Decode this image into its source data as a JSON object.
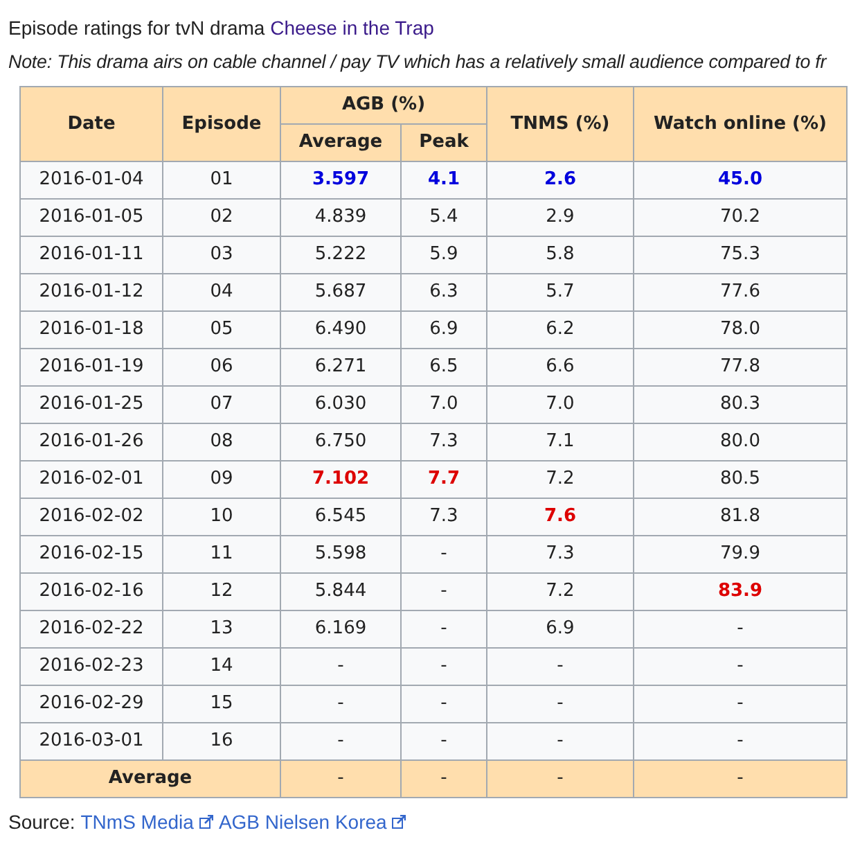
{
  "caption": {
    "text": "Episode ratings for tvN drama ",
    "link": "Cheese in the Trap"
  },
  "note": "Note: This drama airs on cable channel / pay TV which has a relatively small audience compared to fr",
  "table": {
    "columns": {
      "date": "Date",
      "episode": "Episode",
      "agb": "AGB (%)",
      "agb_average": "Average",
      "agb_peak": "Peak",
      "tnms": "TNMS (%)",
      "online": "Watch online (%)"
    },
    "rows": [
      {
        "date": "2016-01-04",
        "episode": "01",
        "values": [
          {
            "text": "3.597",
            "lowest": true,
            "highest": false
          },
          {
            "text": "4.1",
            "lowest": true,
            "highest": false
          },
          {
            "text": "2.6",
            "lowest": true,
            "highest": false
          },
          {
            "text": "45.0",
            "lowest": true,
            "highest": false
          }
        ]
      },
      {
        "date": "2016-01-05",
        "episode": "02",
        "values": [
          {
            "text": "4.839",
            "lowest": false,
            "highest": false
          },
          {
            "text": "5.4",
            "lowest": false,
            "highest": false
          },
          {
            "text": "2.9",
            "lowest": false,
            "highest": false
          },
          {
            "text": "70.2",
            "lowest": false,
            "highest": false
          }
        ]
      },
      {
        "date": "2016-01-11",
        "episode": "03",
        "values": [
          {
            "text": "5.222",
            "lowest": false,
            "highest": false
          },
          {
            "text": "5.9",
            "lowest": false,
            "highest": false
          },
          {
            "text": "5.8",
            "lowest": false,
            "highest": false
          },
          {
            "text": "75.3",
            "lowest": false,
            "highest": false
          }
        ]
      },
      {
        "date": "2016-01-12",
        "episode": "04",
        "values": [
          {
            "text": "5.687",
            "lowest": false,
            "highest": false
          },
          {
            "text": "6.3",
            "lowest": false,
            "highest": false
          },
          {
            "text": "5.7",
            "lowest": false,
            "highest": false
          },
          {
            "text": "77.6",
            "lowest": false,
            "highest": false
          }
        ]
      },
      {
        "date": "2016-01-18",
        "episode": "05",
        "values": [
          {
            "text": "6.490",
            "lowest": false,
            "highest": false
          },
          {
            "text": "6.9",
            "lowest": false,
            "highest": false
          },
          {
            "text": "6.2",
            "lowest": false,
            "highest": false
          },
          {
            "text": "78.0",
            "lowest": false,
            "highest": false
          }
        ]
      },
      {
        "date": "2016-01-19",
        "episode": "06",
        "values": [
          {
            "text": "6.271",
            "lowest": false,
            "highest": false
          },
          {
            "text": "6.5",
            "lowest": false,
            "highest": false
          },
          {
            "text": "6.6",
            "lowest": false,
            "highest": false
          },
          {
            "text": "77.8",
            "lowest": false,
            "highest": false
          }
        ]
      },
      {
        "date": "2016-01-25",
        "episode": "07",
        "values": [
          {
            "text": "6.030",
            "lowest": false,
            "highest": false
          },
          {
            "text": "7.0",
            "lowest": false,
            "highest": false
          },
          {
            "text": "7.0",
            "lowest": false,
            "highest": false
          },
          {
            "text": "80.3",
            "lowest": false,
            "highest": false
          }
        ]
      },
      {
        "date": "2016-01-26",
        "episode": "08",
        "values": [
          {
            "text": "6.750",
            "lowest": false,
            "highest": false
          },
          {
            "text": "7.3",
            "lowest": false,
            "highest": false
          },
          {
            "text": "7.1",
            "lowest": false,
            "highest": false
          },
          {
            "text": "80.0",
            "lowest": false,
            "highest": false
          }
        ]
      },
      {
        "date": "2016-02-01",
        "episode": "09",
        "values": [
          {
            "text": "7.102",
            "lowest": false,
            "highest": true
          },
          {
            "text": "7.7",
            "lowest": false,
            "highest": true
          },
          {
            "text": "7.2",
            "lowest": false,
            "highest": false
          },
          {
            "text": "80.5",
            "lowest": false,
            "highest": false
          }
        ]
      },
      {
        "date": "2016-02-02",
        "episode": "10",
        "values": [
          {
            "text": "6.545",
            "lowest": false,
            "highest": false
          },
          {
            "text": "7.3",
            "lowest": false,
            "highest": false
          },
          {
            "text": "7.6",
            "lowest": false,
            "highest": true
          },
          {
            "text": "81.8",
            "lowest": false,
            "highest": false
          }
        ]
      },
      {
        "date": "2016-02-15",
        "episode": "11",
        "values": [
          {
            "text": "5.598",
            "lowest": false,
            "highest": false
          },
          {
            "text": "-",
            "lowest": false,
            "highest": false
          },
          {
            "text": "7.3",
            "lowest": false,
            "highest": false
          },
          {
            "text": "79.9",
            "lowest": false,
            "highest": false
          }
        ]
      },
      {
        "date": "2016-02-16",
        "episode": "12",
        "values": [
          {
            "text": "5.844",
            "lowest": false,
            "highest": false
          },
          {
            "text": "-",
            "lowest": false,
            "highest": false
          },
          {
            "text": "7.2",
            "lowest": false,
            "highest": false
          },
          {
            "text": "83.9",
            "lowest": false,
            "highest": true
          }
        ]
      },
      {
        "date": "2016-02-22",
        "episode": "13",
        "values": [
          {
            "text": "6.169",
            "lowest": false,
            "highest": false
          },
          {
            "text": "-",
            "lowest": false,
            "highest": false
          },
          {
            "text": "6.9",
            "lowest": false,
            "highest": false
          },
          {
            "text": "-",
            "lowest": false,
            "highest": false
          }
        ]
      },
      {
        "date": "2016-02-23",
        "episode": "14",
        "values": [
          {
            "text": "-",
            "lowest": false,
            "highest": false
          },
          {
            "text": "-",
            "lowest": false,
            "highest": false
          },
          {
            "text": "-",
            "lowest": false,
            "highest": false
          },
          {
            "text": "-",
            "lowest": false,
            "highest": false
          }
        ]
      },
      {
        "date": "2016-02-29",
        "episode": "15",
        "values": [
          {
            "text": "-",
            "lowest": false,
            "highest": false
          },
          {
            "text": "-",
            "lowest": false,
            "highest": false
          },
          {
            "text": "-",
            "lowest": false,
            "highest": false
          },
          {
            "text": "-",
            "lowest": false,
            "highest": false
          }
        ]
      },
      {
        "date": "2016-03-01",
        "episode": "16",
        "values": [
          {
            "text": "-",
            "lowest": false,
            "highest": false
          },
          {
            "text": "-",
            "lowest": false,
            "highest": false
          },
          {
            "text": "-",
            "lowest": false,
            "highest": false
          },
          {
            "text": "-",
            "lowest": false,
            "highest": false
          }
        ]
      }
    ],
    "footer": {
      "label": "Average",
      "values": [
        "-",
        "-",
        "-",
        "-"
      ]
    }
  },
  "source": {
    "label": "Source:",
    "links": [
      "TNmS Media",
      "AGB Nielsen Korea"
    ]
  }
}
